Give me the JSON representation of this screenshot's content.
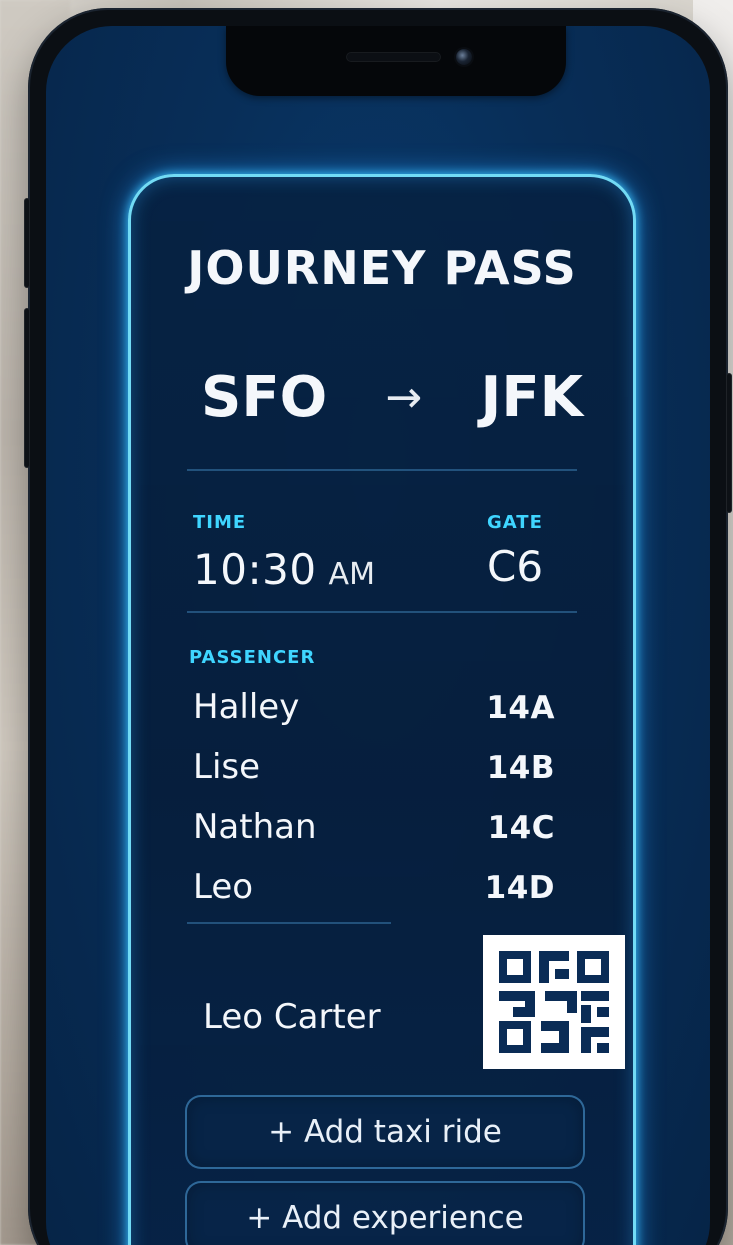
{
  "pass": {
    "title": "JOURNEY PASS",
    "route": {
      "from": "SFO",
      "arrow": "→",
      "to": "JFK"
    },
    "time": {
      "label": "TIME",
      "value": "10:30",
      "ampm": "AM"
    },
    "gate": {
      "label": "GATE",
      "value": "C6"
    },
    "passenger_section": {
      "label": "PASSENCER",
      "items": [
        {
          "name": "Halley",
          "seat": "14A"
        },
        {
          "name": "Lise",
          "seat": "14B"
        },
        {
          "name": "Nathan",
          "seat": "14C"
        },
        {
          "name": "Leo",
          "seat": "14D"
        }
      ]
    },
    "holder_name": "Leo Carter",
    "qr": {
      "icon": "qr-code-icon"
    },
    "actions": {
      "add_taxi_ride": "+ Add taxi ride",
      "add_experience": "+ Add experience"
    }
  },
  "colors": {
    "screen_bg": "#062447",
    "card_glow": "#3fd5ff",
    "label": "#3fd5ff",
    "text": "#f4f7fb",
    "qr_dark": "#0a2c56",
    "qr_bg": "#ffffff"
  }
}
